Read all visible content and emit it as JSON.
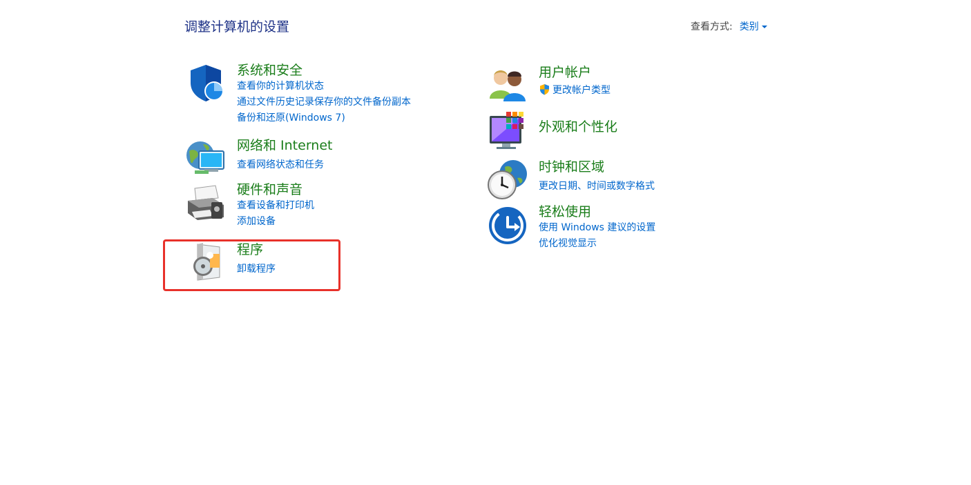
{
  "header": {
    "title": "调整计算机的设置",
    "view_label": "查看方式:",
    "view_value": "类别"
  },
  "categories": {
    "system": {
      "heading": "系统和安全",
      "links": [
        "查看你的计算机状态",
        "通过文件历史记录保存你的文件备份副本",
        "备份和还原(Windows 7)"
      ],
      "icon": "shield-icon"
    },
    "network": {
      "heading": "网络和 Internet",
      "links": [
        "查看网络状态和任务"
      ],
      "icon": "network-globe-icon"
    },
    "hardware": {
      "heading": "硬件和声音",
      "links": [
        "查看设备和打印机",
        "添加设备"
      ],
      "icon": "printer-icon"
    },
    "programs": {
      "heading": "程序",
      "links": [
        "卸载程序"
      ],
      "icon": "programs-disc-icon"
    },
    "users": {
      "heading": "用户帐户",
      "links": [
        "更改帐户类型"
      ],
      "icon": "users-icon"
    },
    "appearance": {
      "heading": "外观和个性化",
      "links": [],
      "icon": "monitor-palette-icon"
    },
    "clock": {
      "heading": "时钟和区域",
      "links": [
        "更改日期、时间或数字格式"
      ],
      "icon": "clock-globe-icon"
    },
    "ease": {
      "heading": "轻松使用",
      "links": [
        "使用 Windows 建议的设置",
        "优化视觉显示"
      ],
      "icon": "ease-of-access-icon"
    }
  },
  "colors": {
    "heading": "#1a7d1a",
    "link": "#0066cc",
    "title": "#1e3287",
    "highlight": "#e8312a"
  }
}
